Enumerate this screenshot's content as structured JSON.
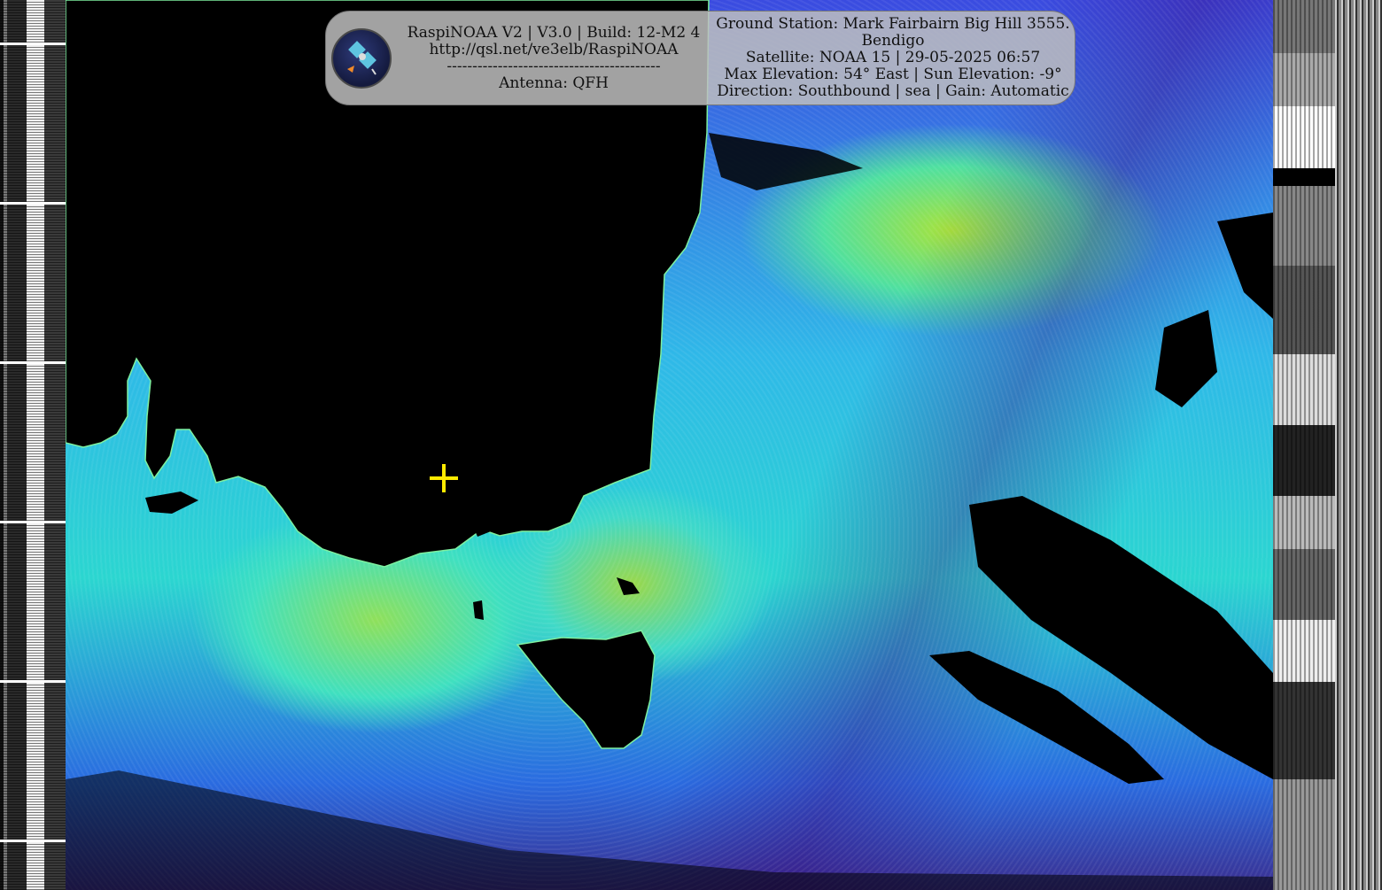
{
  "overlay": {
    "software_line": "RaspiNOAA V2 | V3.0 | Build: 12-M2 4",
    "url_line": "http://qsl.net/ve3elb/RaspiNOAA",
    "divider_line": "------------------------------------------",
    "antenna_line": "Antenna: QFH",
    "ground_station_line": "Ground Station: Mark Fairbairn Big Hill 3555.",
    "location_line": "Bendigo",
    "satellite_line": "Satellite: NOAA 15 | 29-05-2025 06:57",
    "elevation_line": "Max Elevation: 54° East | Sun Elevation: -9°",
    "direction_line": "Direction: Southbound | sea | Gain: Automatic"
  },
  "icons": {
    "logo": "satellite-icon",
    "marker": "crosshair-marker"
  },
  "colors": {
    "marker": "#ffeb00",
    "land": "#000000",
    "coast": "#7ef0a0"
  }
}
